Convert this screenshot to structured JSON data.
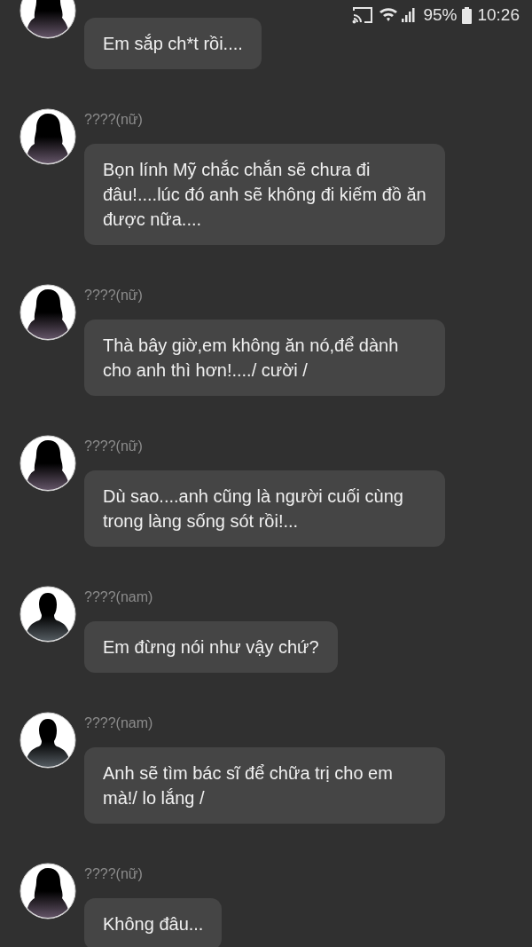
{
  "status_bar": {
    "battery": "95%",
    "time": "10:26"
  },
  "messages": [
    {
      "kind": "female",
      "text": "Em sắp ch*t rồi...."
    },
    {
      "kind": "female",
      "sender": "????(nữ)",
      "text": "Bọn lính Mỹ chắc chắn sẽ chưa đi đâu!....lúc đó anh sẽ không đi kiếm đồ ăn được nữa...."
    },
    {
      "kind": "female",
      "sender": "????(nữ)",
      "text": "Thà bây giờ,em không ăn nó,để dành cho anh thì hơn!..../ cười /"
    },
    {
      "kind": "female",
      "sender": "????(nữ)",
      "text": "Dù sao....anh cũng là người cuối cùng trong làng sống sót rồi!..."
    },
    {
      "kind": "male",
      "sender": "????(nam)",
      "text": "Em đừng nói như vậy chứ?"
    },
    {
      "kind": "male",
      "sender": "????(nam)",
      "text": "Anh sẽ tìm bác sĩ để chữa trị cho em mà!/ lo lắng /"
    },
    {
      "kind": "female",
      "sender": "????(nữ)",
      "text": "Không đâu..."
    }
  ]
}
